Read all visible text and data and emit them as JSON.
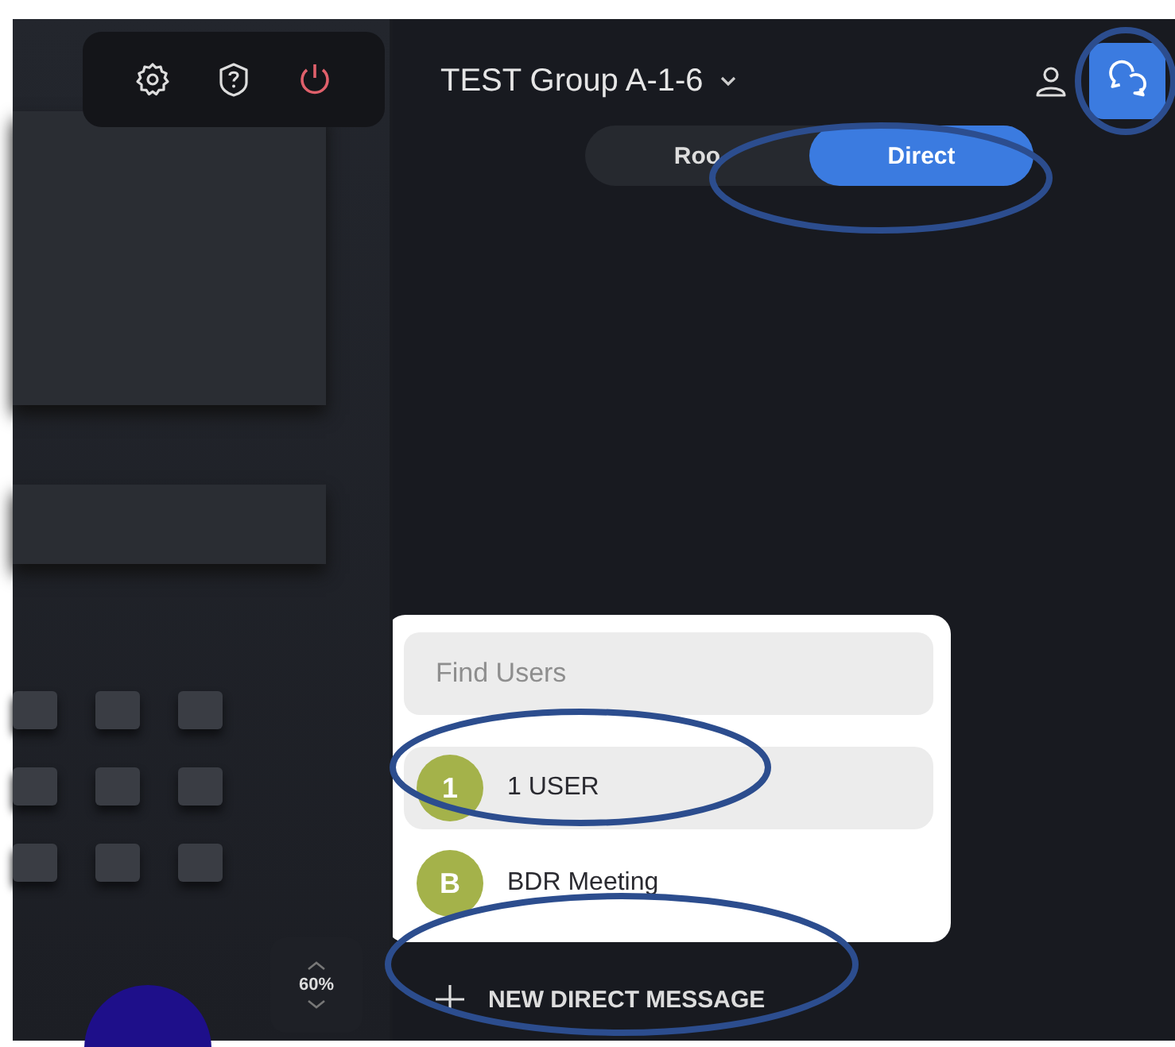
{
  "toolbar": {
    "buttons": [
      {
        "kind": "settings"
      },
      {
        "kind": "help"
      },
      {
        "kind": "power"
      }
    ]
  },
  "header": {
    "title": "TEST Group A-1-6"
  },
  "chat_button": {
    "highlighted": true
  },
  "tabs": [
    {
      "label": "Roo",
      "selected": false,
      "highlighted": false
    },
    {
      "label": "Direct",
      "selected": true,
      "highlighted": true
    }
  ],
  "popup": {
    "search": {
      "placeholder": "Find Users"
    },
    "users": [
      {
        "initial": "1",
        "name": "1 USER",
        "selected": true,
        "highlighted": true
      },
      {
        "initial": "B",
        "name": "BDR Meeting",
        "selected": false,
        "highlighted": false
      }
    ]
  },
  "new_message_button": {
    "label": "NEW DIRECT MESSAGE",
    "highlighted": true
  },
  "zoom": {
    "label": "60%"
  }
}
